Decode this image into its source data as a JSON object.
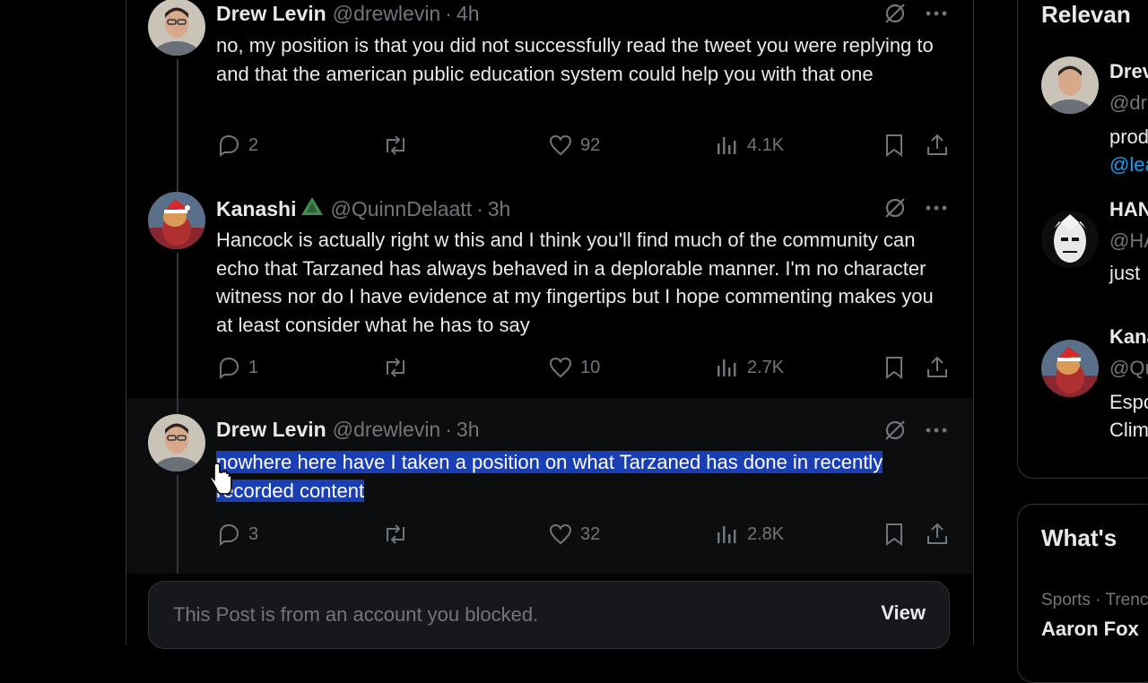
{
  "posts": [
    {
      "name": "Drew Levin",
      "badge": "",
      "handle": "@drewlevin",
      "separator": "·",
      "time": "4h",
      "text": "no, my position is that you did not successfully read the tweet you were replying to and that the american public education system could help you with that one",
      "replies": "2",
      "likes": "92",
      "views": "4.1K"
    },
    {
      "name": "Kanashi",
      "badge": "triangle-emoji",
      "handle": "@QuinnDelaatt",
      "separator": "·",
      "time": "3h",
      "text": "Hancock is actually right w this and I think you'll find much of the community can echo that Tarzaned has always behaved in a deplorable manner. I'm no character witness nor do I have evidence at my fingertips but I hope commenting makes you at least consider what he has to say",
      "replies": "1",
      "likes": "10",
      "views": "2.7K"
    },
    {
      "name": "Drew Levin",
      "badge": "",
      "handle": "@drewlevin",
      "separator": "·",
      "time": "3h",
      "text": "nowhere here have I taken a position on what Tarzaned has done in recently recorded content",
      "replies": "3",
      "likes": "32",
      "views": "2.8K"
    }
  ],
  "blocked_notice": {
    "message": "This Post is from an account you blocked.",
    "view_label": "View"
  },
  "sidebar": {
    "relevant_title": "Relevan",
    "users": [
      {
        "name": "Drev",
        "handle": "@dr",
        "bio1": "prod",
        "bio2": "@lea"
      },
      {
        "name": "HAN",
        "handle": "@HA",
        "bio1": "just",
        "bio2": ""
      },
      {
        "name": "Kana",
        "handle": "@Qu",
        "bio1": "Espo",
        "bio2": "Clim"
      }
    ],
    "whats_title": "What's",
    "trend_meta": "Sports · Trenc",
    "trend_name": "Aaron Fox"
  },
  "icons": {
    "reply": "reply-icon",
    "repost": "repost-icon",
    "like": "heart-icon",
    "views": "analytics-icon",
    "bookmark": "bookmark-icon",
    "share": "share-icon",
    "grok": "grok-icon",
    "more": "more-icon"
  },
  "colors": {
    "background": "#000000",
    "muted": "#71767b",
    "selection": "#1a3fb5",
    "link": "#1d9bf0"
  }
}
